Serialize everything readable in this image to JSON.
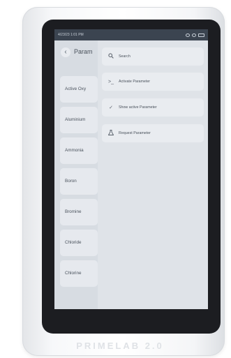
{
  "status": {
    "time": "4/23/23 1:01 PM"
  },
  "header": {
    "back_glyph": "‹",
    "title": "Param"
  },
  "list": {
    "items": [
      "Active Oxy",
      "Aluminium",
      "Ammonia",
      "Boron",
      "Bromine",
      "Chloride",
      "Chlorine"
    ]
  },
  "menu": {
    "search_label": "Search",
    "activate_label": "Activate Parameter",
    "show_active_label": "Show active Parameter",
    "request_label": "Request Parameter",
    "search_icon": "search-icon",
    "activate_icon": "terminal-icon",
    "show_active_icon": "check-icon",
    "request_icon": "flask-icon"
  },
  "device": {
    "brand": "PRIMELAB 2.0"
  },
  "colors": {
    "screen_bg": "#d7dce2",
    "statusbar": "#3b4450",
    "bezel": "#1c1d21"
  }
}
